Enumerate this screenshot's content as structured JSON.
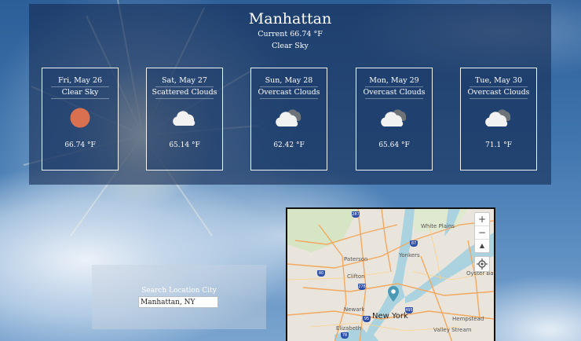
{
  "location": {
    "city": "Manhattan",
    "current": "Current 66.74 °F",
    "condition": "Clear Sky"
  },
  "forecast": [
    {
      "date": "Fri, May 26",
      "condition": "Clear Sky",
      "icon": "sun-icon",
      "temp": "66.74 °F"
    },
    {
      "date": "Sat, May 27",
      "condition": "Scattered Clouds",
      "icon": "cloud-icon",
      "temp": "65.14 °F"
    },
    {
      "date": "Sun, May 28",
      "condition": "Overcast Clouds",
      "icon": "overcast-clouds-icon",
      "temp": "62.42 °F"
    },
    {
      "date": "Mon, May 29",
      "condition": "Overcast Clouds",
      "icon": "overcast-clouds-icon",
      "temp": "65.64 °F"
    },
    {
      "date": "Tue, May 30",
      "condition": "Overcast Clouds",
      "icon": "overcast-clouds-icon",
      "temp": "71.1 °F"
    }
  ],
  "search": {
    "label": "Search Location City",
    "value": "Manhattan, NY"
  },
  "map": {
    "zoom_in": "+",
    "zoom_out": "−",
    "compass": "▲",
    "labels": {
      "white_plains": "White Plains",
      "yonkers": "Yonkers",
      "paterson": "Paterson",
      "clifton": "Clifton",
      "oyster_bay": "Oyster Bay",
      "newark": "Newark",
      "new_york": "New York",
      "elizabeth": "Elizabeth",
      "hempstead": "Hempstead",
      "valley_stream": "Valley Stream"
    },
    "shields": {
      "i287": "287",
      "i87": "87",
      "i95": "95",
      "i80": "80",
      "i278": "278",
      "i95b": "95",
      "i495": "495",
      "i78": "78"
    }
  },
  "colors": {
    "sun": "#d9704f",
    "panel": "#16355a",
    "water": "#aad3df",
    "roads": "#f3a85f"
  }
}
